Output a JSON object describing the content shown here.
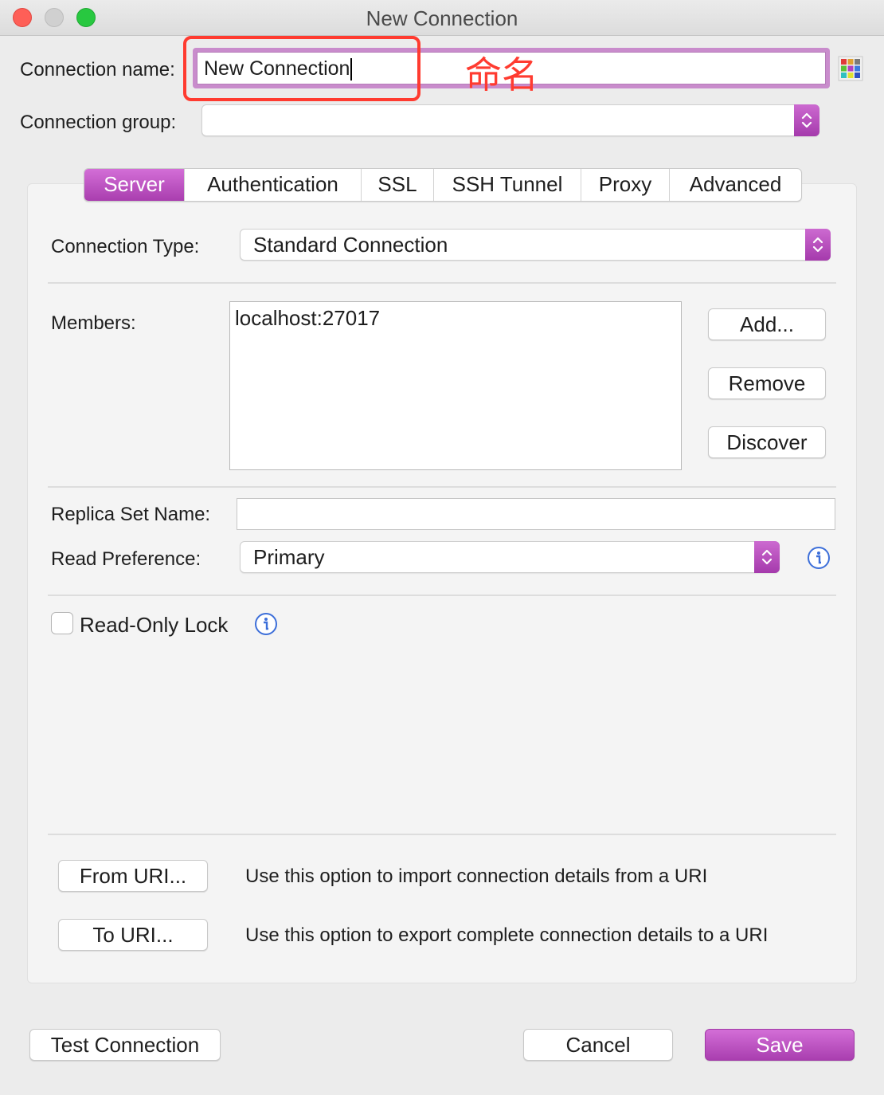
{
  "window": {
    "title": "New Connection"
  },
  "connection_name": {
    "label": "Connection name:",
    "value": "New Connection"
  },
  "annotation": {
    "text": "命名",
    "color": "#ff3b30"
  },
  "connection_group": {
    "label": "Connection group:",
    "value": ""
  },
  "tabs": [
    {
      "label": "Server",
      "active": true
    },
    {
      "label": "Authentication"
    },
    {
      "label": "SSL"
    },
    {
      "label": "SSH Tunnel"
    },
    {
      "label": "Proxy"
    },
    {
      "label": "Advanced"
    }
  ],
  "server": {
    "connection_type": {
      "label": "Connection Type:",
      "value": "Standard Connection"
    },
    "members": {
      "label": "Members:",
      "items": [
        "localhost:27017"
      ]
    },
    "member_buttons": {
      "add": "Add...",
      "remove": "Remove",
      "discover": "Discover"
    },
    "replica_set": {
      "label": "Replica Set Name:",
      "value": ""
    },
    "read_preference": {
      "label": "Read Preference:",
      "value": "Primary"
    },
    "read_only_lock": {
      "label": "Read-Only Lock",
      "checked": false
    }
  },
  "uri": {
    "from_button": "From URI...",
    "from_desc": "Use this option to import connection details from a URI",
    "to_button": "To URI...",
    "to_desc": "Use this option to export complete connection details to a URI"
  },
  "footer": {
    "test": "Test Connection",
    "cancel": "Cancel",
    "save": "Save"
  },
  "colors": {
    "accent": "#b84dbd",
    "close": "#fe5f57",
    "minimize": "#d0d0d0",
    "zoom": "#28c840"
  }
}
